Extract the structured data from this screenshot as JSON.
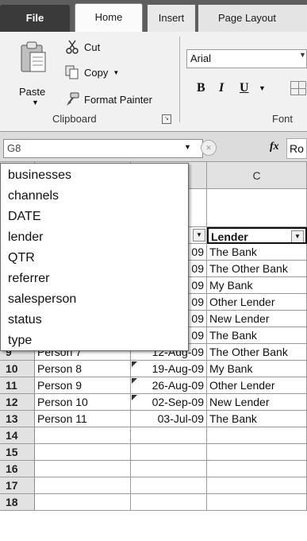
{
  "tabs": {
    "file": "File",
    "home": "Home",
    "insert": "Insert",
    "page_layout": "Page Layout"
  },
  "clipboard": {
    "paste": "Paste",
    "cut": "Cut",
    "copy": "Copy",
    "format_painter": "Format Painter",
    "group_label": "Clipboard"
  },
  "font": {
    "family": "Arial",
    "bold": "B",
    "italic": "I",
    "underline": "U",
    "group_label": "Font"
  },
  "formula_bar": {
    "name_box": "G8",
    "fx": "fx",
    "content": "Ro"
  },
  "grid": {
    "col_c": "C",
    "header_row": {
      "lender": "Lender"
    },
    "rows": [
      {
        "num": "",
        "a": "",
        "b": "09",
        "c": "The Bank"
      },
      {
        "num": "",
        "a": "",
        "b": "09",
        "c": "The Other Bank"
      },
      {
        "num": "",
        "a": "",
        "b": "09",
        "c": "My Bank"
      },
      {
        "num": "",
        "a": "",
        "b": "09",
        "c": "Other Lender"
      },
      {
        "num": "",
        "a": "",
        "b": "09",
        "c": "New Lender"
      },
      {
        "num": "",
        "a": "",
        "b": "09",
        "c": "The Bank"
      },
      {
        "num": "9",
        "a": "Person 7",
        "b": "12-Aug-09",
        "c": "The Other Bank"
      },
      {
        "num": "10",
        "a": "Person 8",
        "b": "19-Aug-09",
        "c": "My Bank"
      },
      {
        "num": "11",
        "a": "Person 9",
        "b": "26-Aug-09",
        "c": "Other Lender"
      },
      {
        "num": "12",
        "a": "Person 10",
        "b": "02-Sep-09",
        "c": "New Lender"
      },
      {
        "num": "13",
        "a": "Person 11",
        "b": "03-Jul-09",
        "c": "The Bank"
      },
      {
        "num": "14",
        "a": "",
        "b": "",
        "c": ""
      },
      {
        "num": "15",
        "a": "",
        "b": "",
        "c": ""
      },
      {
        "num": "16",
        "a": "",
        "b": "",
        "c": ""
      },
      {
        "num": "17",
        "a": "",
        "b": "",
        "c": ""
      },
      {
        "num": "18",
        "a": "",
        "b": "",
        "c": ""
      }
    ]
  },
  "name_dropdown": {
    "items": [
      "businesses",
      "channels",
      "DATE",
      "lender",
      "QTR",
      "referrer",
      "salesperson",
      "status",
      "type"
    ]
  },
  "icons": {
    "paste": "clipboard-icon",
    "cut": "scissors-icon",
    "copy": "copy-icon",
    "format_painter": "paintbrush-icon"
  }
}
